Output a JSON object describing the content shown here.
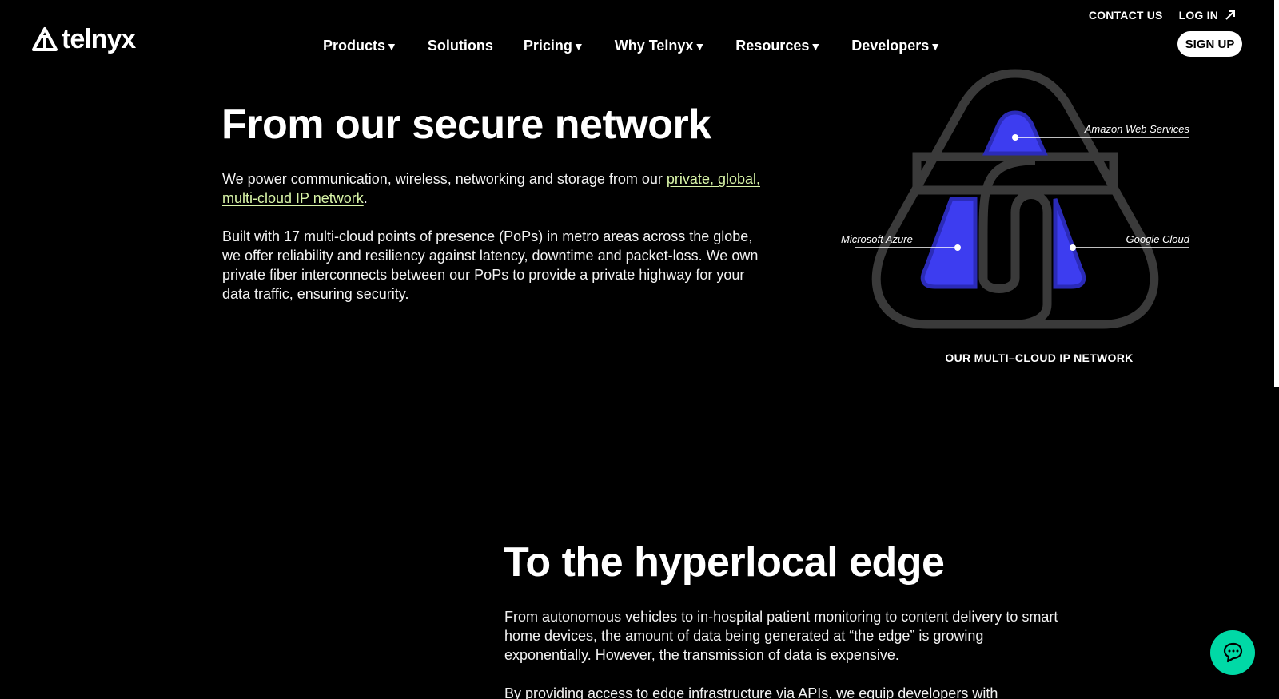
{
  "topbar": {
    "contact": "CONTACT US",
    "login": "LOG IN"
  },
  "brand": {
    "name": "telnyx"
  },
  "nav": {
    "items": [
      {
        "label": "Products",
        "caret": "▼"
      },
      {
        "label": "Solutions",
        "caret": ""
      },
      {
        "label": "Pricing",
        "caret": "▼"
      },
      {
        "label": "Why Telnyx",
        "caret": "▼"
      },
      {
        "label": "Resources",
        "caret": "▼"
      },
      {
        "label": "Developers",
        "caret": "▼"
      }
    ],
    "signup": "SIGN UP"
  },
  "section1": {
    "title": "From our secure network",
    "p1_prefix": "We power communication, wireless, networking and storage from our ",
    "p1_link": "private, global, multi-cloud IP network",
    "p1_suffix": ".",
    "p2": "Built with 17 multi-cloud points of presence (PoPs) in metro areas across the globe, we offer reliability and resiliency against latency, downtime and packet-loss. We own private fiber interconnects between our PoPs to provide a private highway for your data traffic, ensuring security."
  },
  "diagram": {
    "labels": {
      "aws": "Amazon Web Services",
      "azure": "Microsoft Azure",
      "gcp": "Google Cloud"
    },
    "caption": "OUR MULTI–CLOUD IP NETWORK",
    "colors": {
      "accent": "#3d3df0",
      "accent_dark": "#2b2bb8",
      "outline": "#3a3a3a"
    }
  },
  "section2": {
    "title": "To the hyperlocal edge",
    "p1": "From autonomous vehicles to in-hospital patient monitoring to content delivery to smart home devices, the amount of data being generated at “the edge” is growing exponentially. However, the transmission of data is expensive.",
    "p2": "By providing access to edge infrastructure via APIs, we equip developers with"
  },
  "icons": {
    "chat": "chat-icon",
    "arrow": "arrow-up-right-icon"
  },
  "colors": {
    "background": "#000000",
    "link": "#d9f5a8",
    "chat": "#00d9a6"
  }
}
